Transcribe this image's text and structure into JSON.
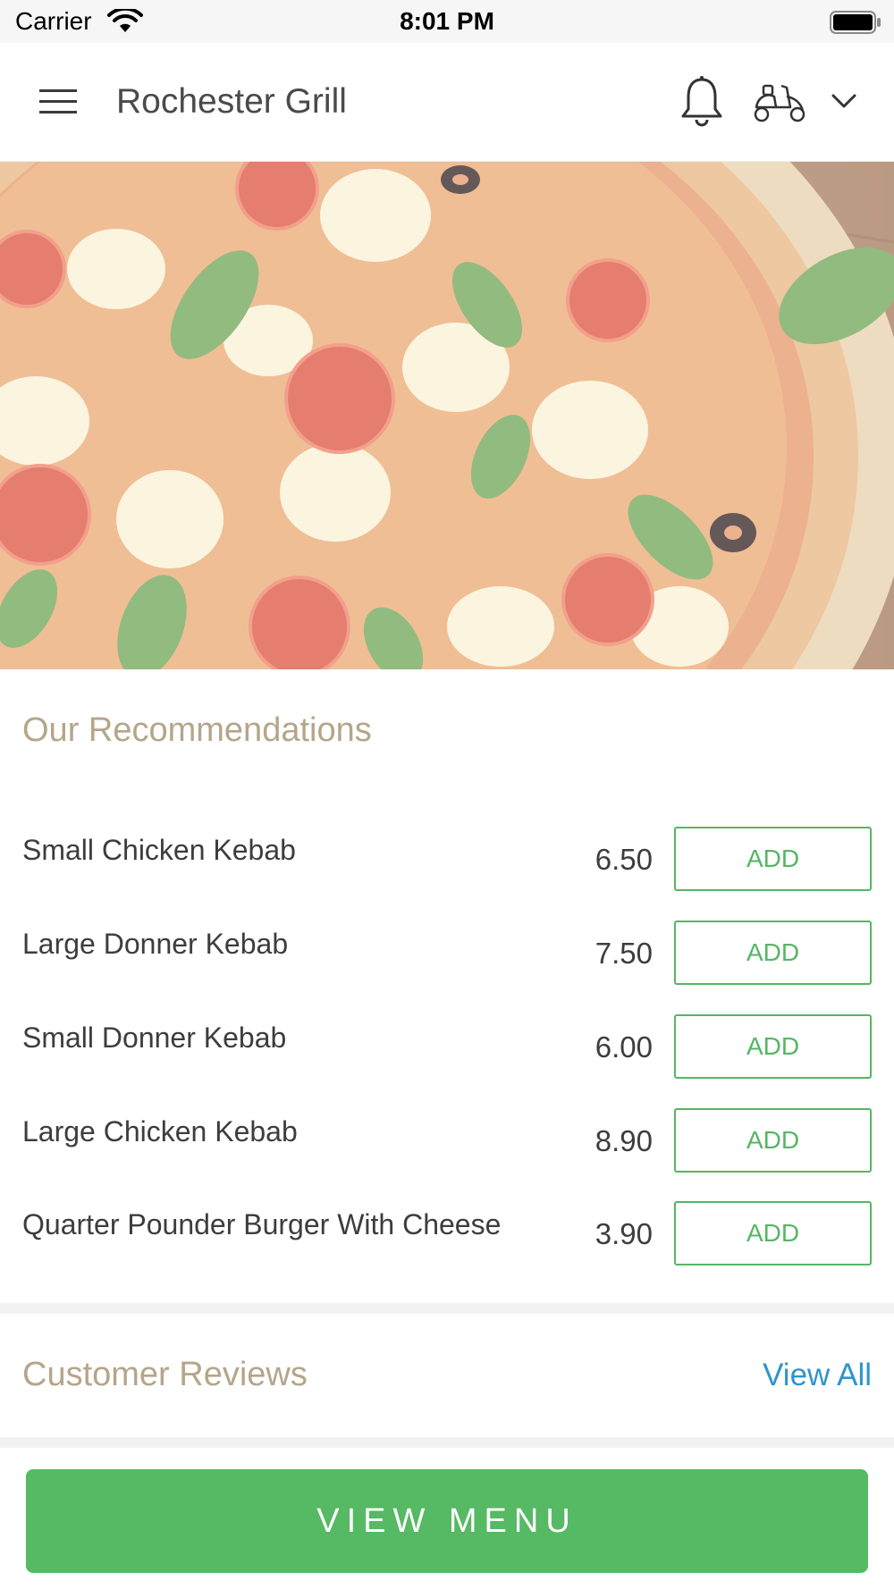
{
  "status_bar": {
    "carrier": "Carrier",
    "time": "8:01 PM"
  },
  "nav": {
    "title": "Rochester Grill",
    "icons": [
      "menu-icon",
      "bell-icon",
      "scooter-icon",
      "chevron-down-icon"
    ]
  },
  "hero": {
    "image": "pizza-hero-image"
  },
  "recommendations": {
    "title": "Our Recommendations",
    "items": [
      {
        "name": "Small Chicken Kebab",
        "price": "6.50",
        "button": "ADD"
      },
      {
        "name": "Large Donner Kebab",
        "price": "7.50",
        "button": "ADD"
      },
      {
        "name": "Small Donner Kebab",
        "price": "6.00",
        "button": "ADD"
      },
      {
        "name": "Large Chicken Kebab",
        "price": "8.90",
        "button": "ADD"
      },
      {
        "name": "Quarter Pounder Burger With Cheese",
        "price": "3.90",
        "button": "ADD"
      }
    ]
  },
  "reviews": {
    "title": "Customer Reviews",
    "view_all": "View All"
  },
  "footer": {
    "view_menu": "VIEW MENU"
  },
  "colors": {
    "accent_green": "#55b664",
    "section_title": "#b5a58a",
    "link_blue": "#2e95cc"
  }
}
